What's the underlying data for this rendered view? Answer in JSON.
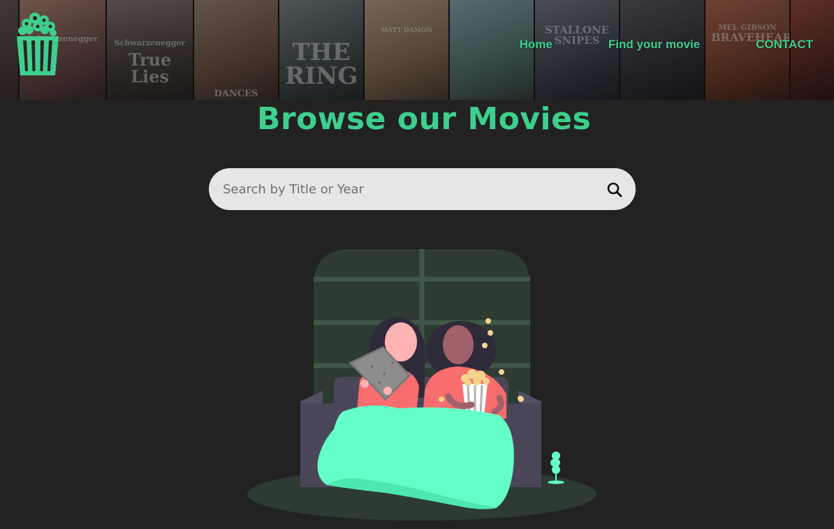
{
  "header": {
    "logo_icon": "popcorn-icon",
    "posters": [
      {
        "title": ""
      },
      {
        "title": "True Lies",
        "subtitle": "Schwarzenegger"
      },
      {
        "title": "DANCES"
      },
      {
        "title": "THE RING"
      },
      {
        "title": "MATT DAMON"
      },
      {
        "title": ""
      },
      {
        "title": "STALLONE SNIPES"
      },
      {
        "title": ""
      },
      {
        "title": "BRAVEHEART",
        "subtitle": "MEL GIBSON"
      },
      {
        "title": ""
      }
    ]
  },
  "nav": {
    "home": "Home",
    "find": "Find your movie",
    "contact": "CONTACT"
  },
  "main": {
    "title": "Browse our Movies",
    "search_placeholder": "Search by Title or Year",
    "search_icon": "search-icon"
  },
  "colors": {
    "accent": "#3ecf8e",
    "background": "#222222",
    "search_bg": "#e6e6e6",
    "blanket": "#64ffc8"
  }
}
